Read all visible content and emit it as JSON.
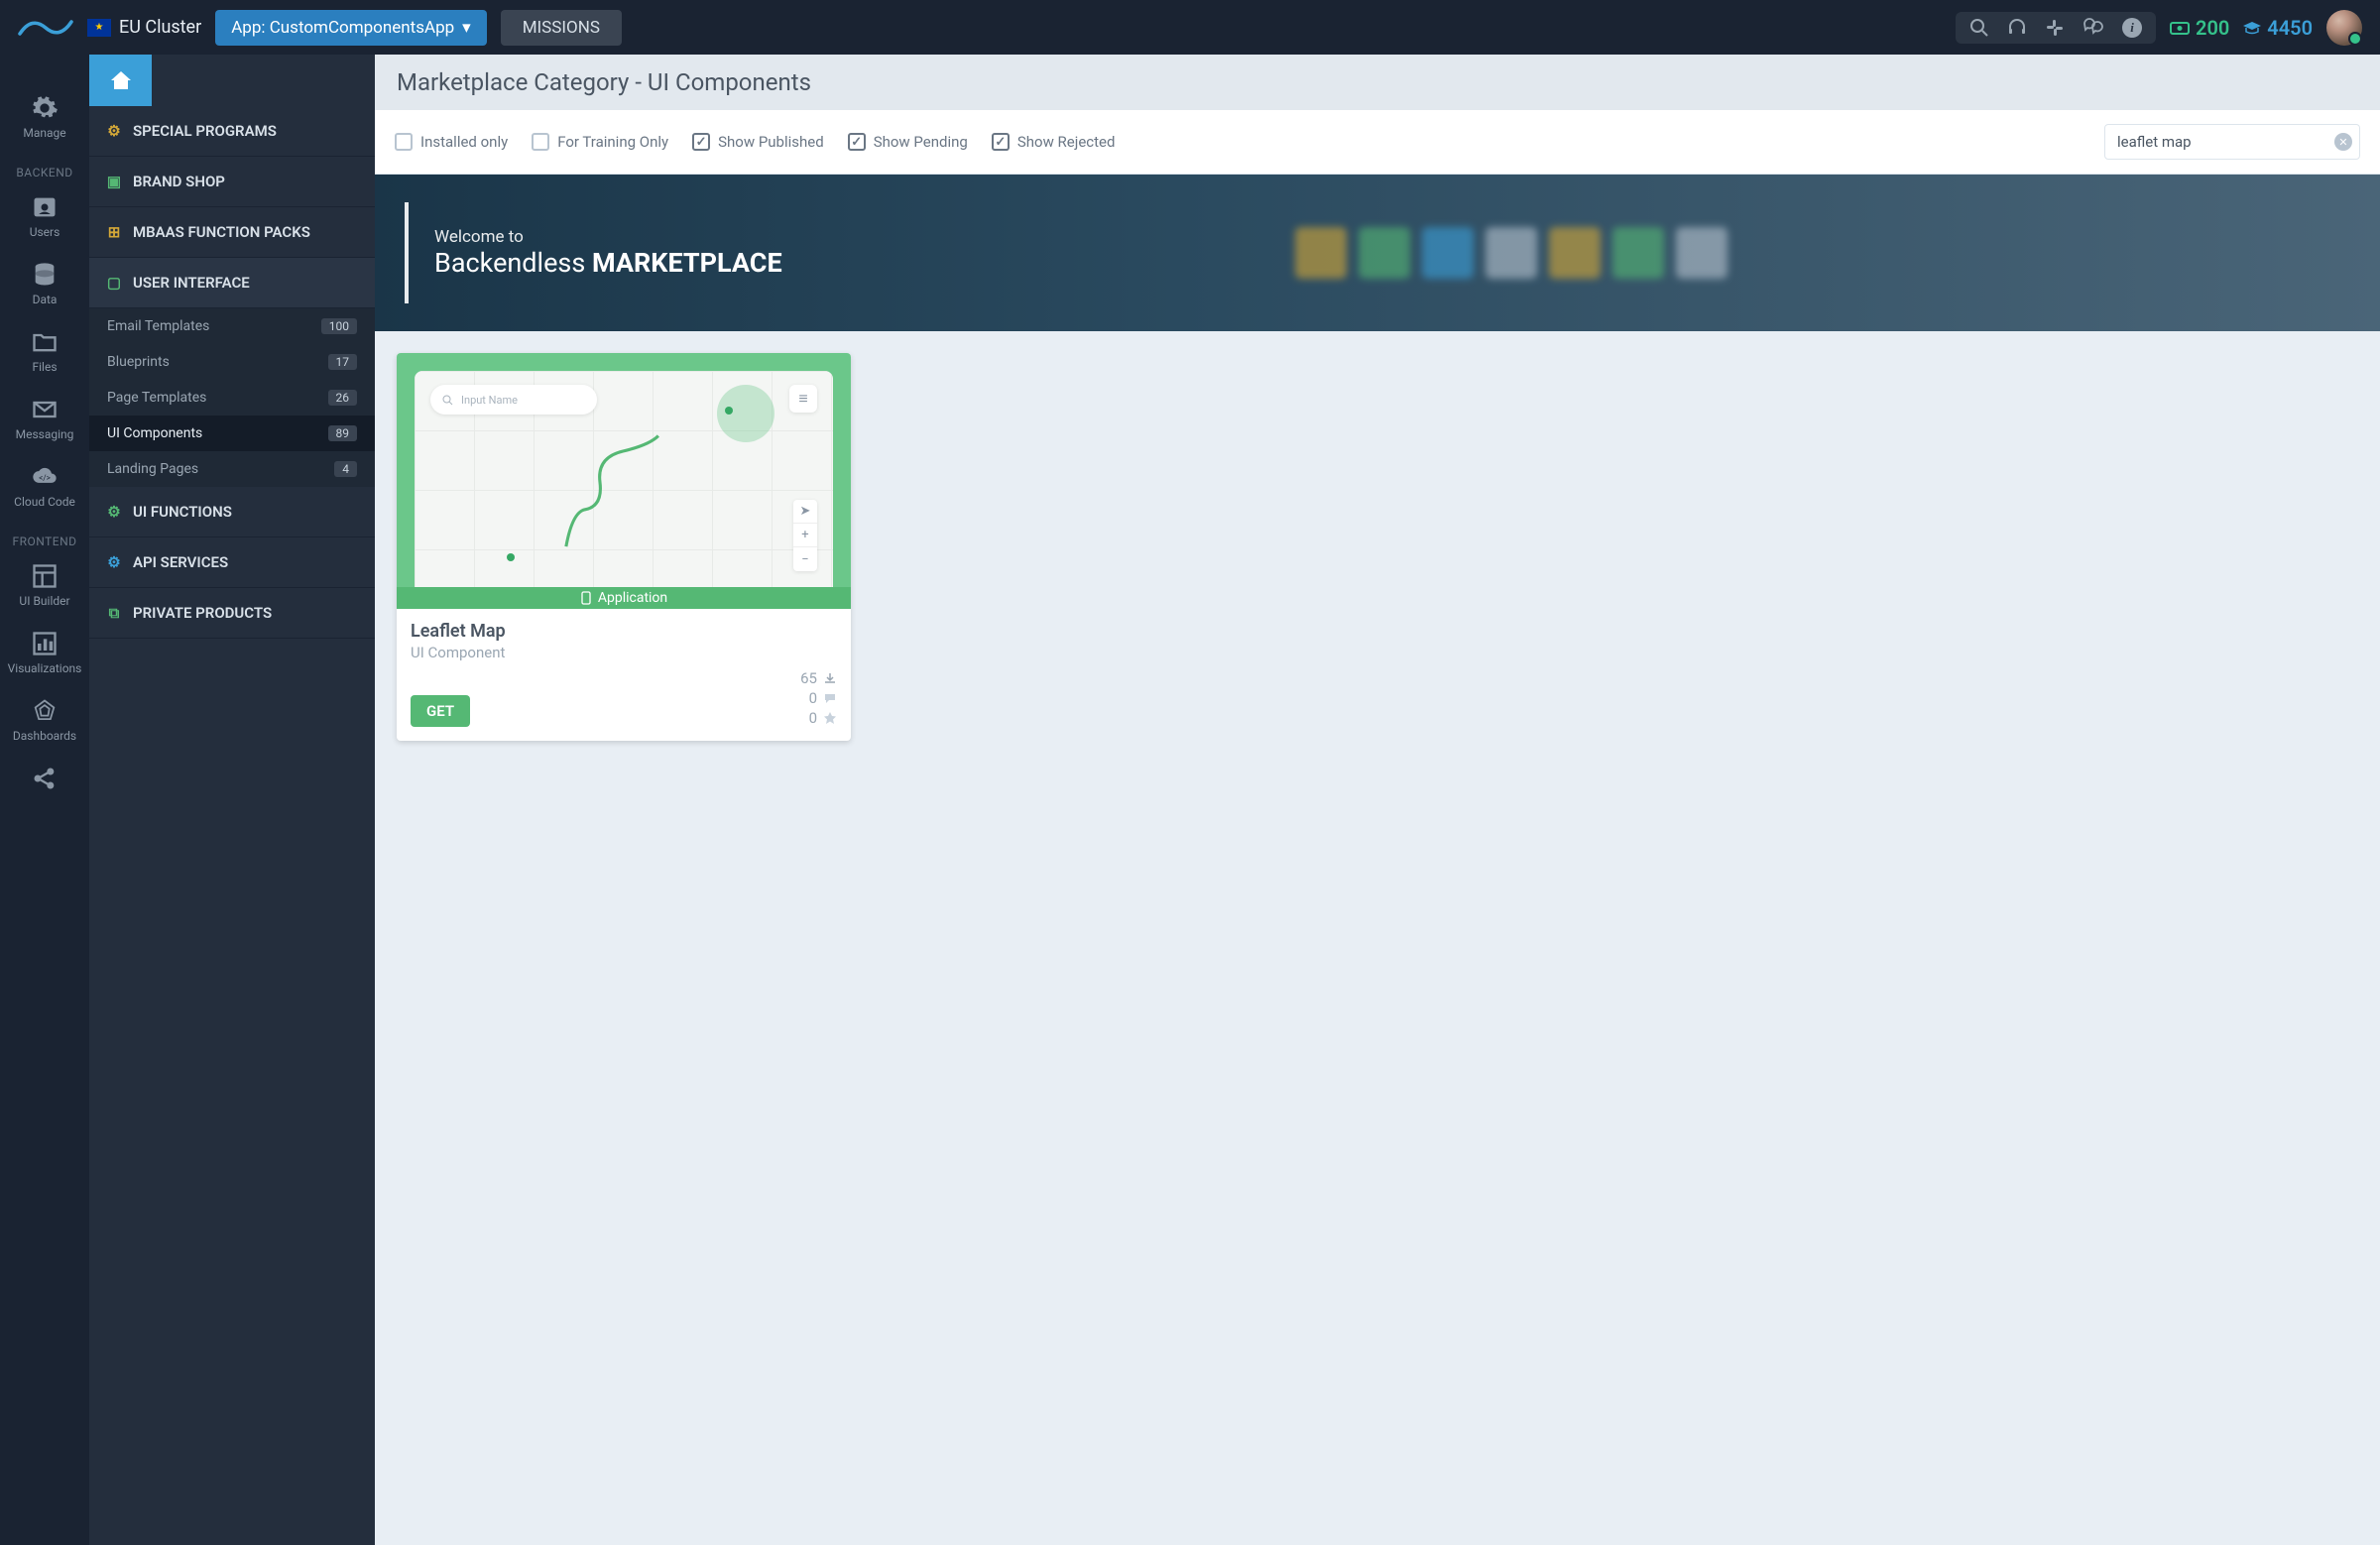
{
  "topbar": {
    "cluster": "EU Cluster",
    "app_selector": "App: CustomComponentsApp",
    "missions": "MISSIONS",
    "credits_money": "200",
    "credits_grad": "4450"
  },
  "rail": {
    "manage": "Manage",
    "backend_header": "BACKEND",
    "users": "Users",
    "data": "Data",
    "files": "Files",
    "messaging": "Messaging",
    "cloud_code": "Cloud Code",
    "frontend_header": "FRONTEND",
    "ui_builder": "UI Builder",
    "visualizations": "Visualizations",
    "dashboards": "Dashboards"
  },
  "sidebar": {
    "sections": {
      "special": "SPECIAL PROGRAMS",
      "brand": "BRAND SHOP",
      "mbaas": "MBAAS FUNCTION PACKS",
      "ui": "USER INTERFACE",
      "ui_funcs": "UI FUNCTIONS",
      "api": "API SERVICES",
      "private": "PRIVATE PRODUCTS"
    },
    "ui_items": [
      {
        "label": "Email Templates",
        "count": "100"
      },
      {
        "label": "Blueprints",
        "count": "17"
      },
      {
        "label": "Page Templates",
        "count": "26"
      },
      {
        "label": "UI Components",
        "count": "89"
      },
      {
        "label": "Landing Pages",
        "count": "4"
      }
    ]
  },
  "main": {
    "title": "Marketplace Category - UI Components",
    "filters": {
      "installed": "Installed only",
      "training": "For Training Only",
      "published": "Show Published",
      "pending": "Show Pending",
      "rejected": "Show Rejected"
    },
    "search_value": "leaflet map",
    "hero_small": "Welcome to",
    "hero_brand": "Backendless",
    "hero_big": "MARKETPLACE"
  },
  "card": {
    "tag": "Application",
    "map_input": "Input Name",
    "title": "Leaflet Map",
    "subtitle": "UI Component",
    "get": "GET",
    "downloads": "65",
    "comments": "0",
    "stars": "0"
  }
}
